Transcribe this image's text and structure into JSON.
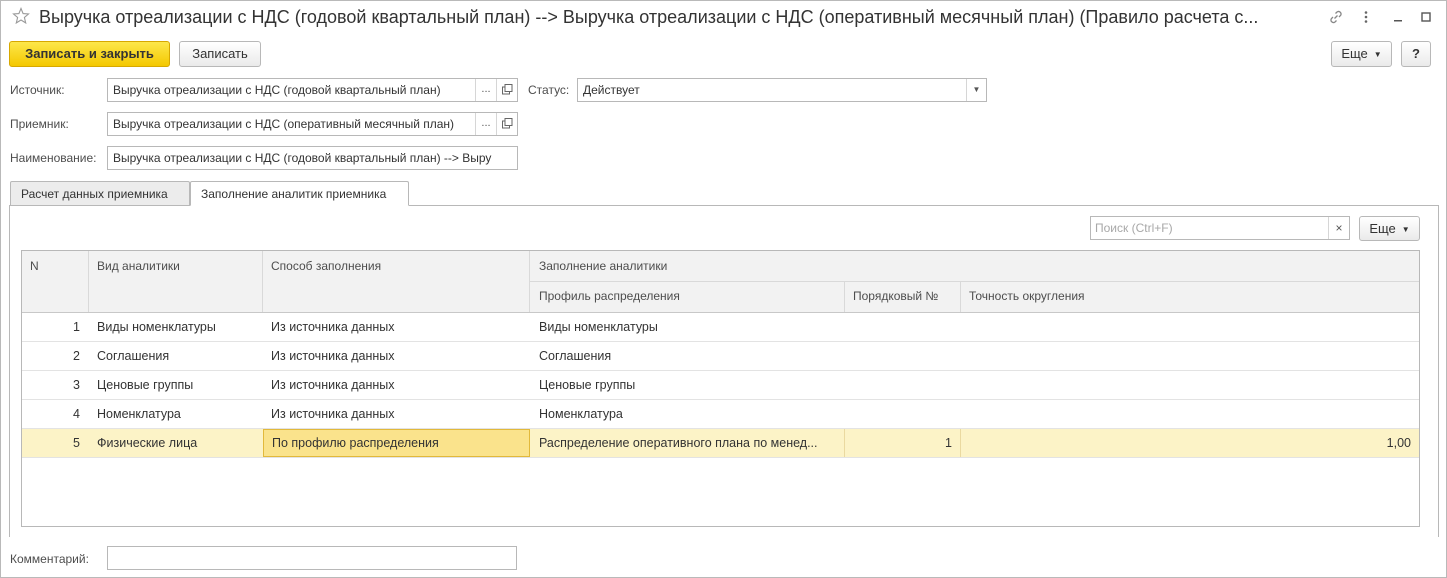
{
  "window": {
    "title": "Выручка отреализации с НДС (годовой квартальный план) --> Выручка отреализации с НДС (оперативный месячный план) (Правило расчета с...",
    "icons": [
      "star-icon",
      "link-icon",
      "more-vertical-icon",
      "minimize-icon",
      "maximize-icon"
    ]
  },
  "toolbar": {
    "save_close_label": "Записать и закрыть",
    "save_label": "Записать",
    "more_label": "Еще",
    "help_label": "?"
  },
  "form": {
    "source_label": "Источник:",
    "source_value": "Выручка отреализации с НДС (годовой квартальный план)",
    "receiver_label": "Приемник:",
    "receiver_value": "Выручка отреализации с НДС (оперативный месячный план)",
    "name_label": "Наименование:",
    "name_value": "Выручка отреализации с НДС (годовой квартальный план) --> Выру",
    "status_label": "Статус:",
    "status_value": "Действует",
    "choose_btn": "...",
    "comment_label": "Комментарий:",
    "comment_value": ""
  },
  "tabs": [
    {
      "label": "Расчет данных приемника",
      "active": false
    },
    {
      "label": "Заполнение аналитик приемника",
      "active": true
    }
  ],
  "search": {
    "placeholder": "Поиск (Ctrl+F)",
    "clear": "×",
    "more_label": "Еще"
  },
  "table": {
    "headers": {
      "n": "N",
      "kind": "Вид аналитики",
      "method": "Способ заполнения",
      "group": "Заполнение аналитики",
      "profile": "Профиль распределения",
      "order": "Порядковый №",
      "precision": "Точность округления"
    },
    "rows": [
      {
        "n": "1",
        "kind": "Виды номенклатуры",
        "method": "Из источника данных",
        "profile": "Виды номенклатуры",
        "order": "",
        "precision": ""
      },
      {
        "n": "2",
        "kind": "Соглашения",
        "method": "Из источника данных",
        "profile": "Соглашения",
        "order": "",
        "precision": ""
      },
      {
        "n": "3",
        "kind": "Ценовые группы",
        "method": "Из источника данных",
        "profile": "Ценовые группы",
        "order": "",
        "precision": ""
      },
      {
        "n": "4",
        "kind": "Номенклатура",
        "method": "Из источника данных",
        "profile": "Номенклатура",
        "order": "",
        "precision": ""
      },
      {
        "n": "5",
        "kind": "Физические лица",
        "method": "По профилю распределения",
        "profile": "Распределение оперативного плана по менед...",
        "order": "1",
        "precision": "1,00"
      }
    ]
  },
  "colors": {
    "primary_button": "#f4c800",
    "selected_row": "#fcf3c7",
    "focused_cell": "#fae38c"
  }
}
